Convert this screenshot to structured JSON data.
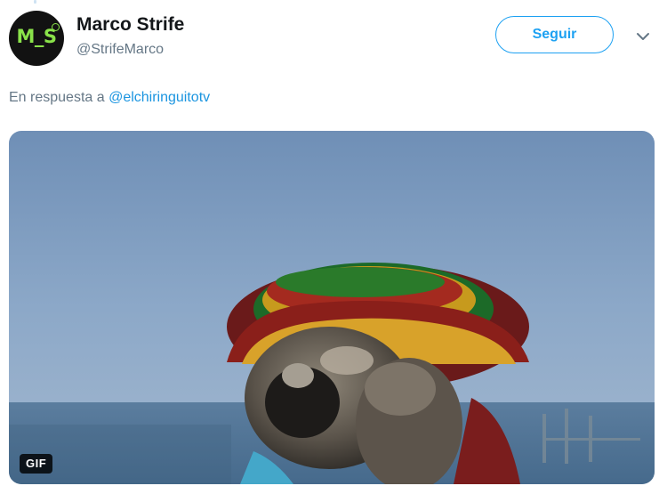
{
  "tweet": {
    "avatar_text": "M_S",
    "display_name": "Marco Strife",
    "handle": "@StrifeMarco",
    "follow_label": "Seguir",
    "reply_prefix": "En respuesta a",
    "reply_mention": "@elchiringuitotv",
    "media_badge": "GIF"
  },
  "icons": {
    "more_menu": "chevron-down-icon"
  },
  "colors": {
    "accent": "#1da1f2",
    "mention": "#1b95e0",
    "secondary_text": "#657786",
    "avatar_bg": "#121212",
    "avatar_text": "#8ae34a"
  }
}
